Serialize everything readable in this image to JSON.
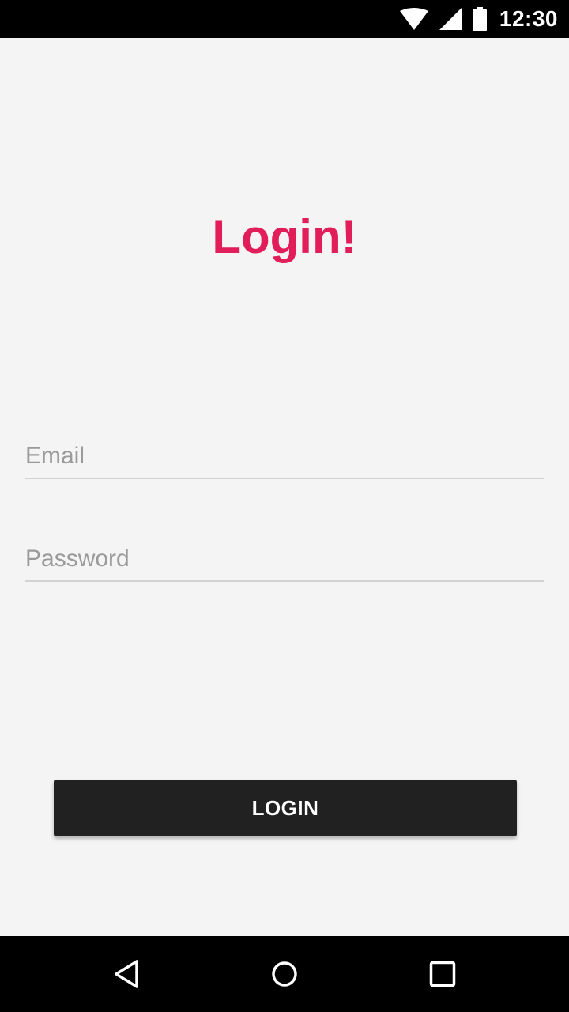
{
  "status_bar": {
    "time": "12:30",
    "icons": [
      "wifi-icon",
      "cell-signal-icon",
      "battery-icon"
    ]
  },
  "login": {
    "title": "Login!",
    "email_placeholder": "Email",
    "email_value": "",
    "password_placeholder": "Password",
    "password_value": "",
    "button_label": "LOGIN"
  },
  "nav_bar": {
    "icons": [
      "back-icon",
      "home-icon",
      "recents-icon"
    ]
  },
  "colors": {
    "accent": "#e11d5a",
    "button": "#212121",
    "background": "#f4f4f4"
  }
}
